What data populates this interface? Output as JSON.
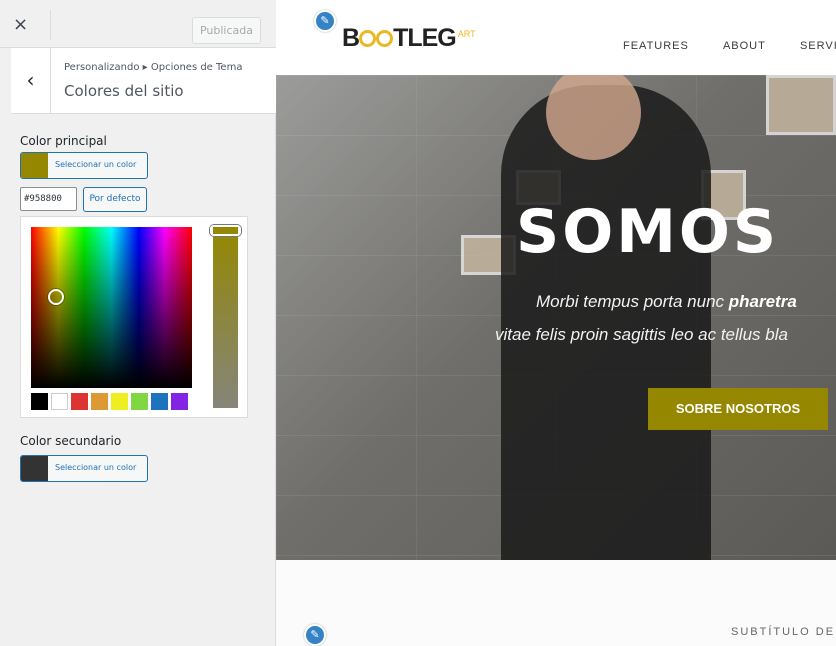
{
  "customizer": {
    "close_icon": "×",
    "publish_label": "Publicada",
    "back_icon": "‹",
    "breadcrumb": "Personalizando ▸ Opciones de Tema",
    "section_title": "Colores del sitio",
    "primary": {
      "label": "Color principal",
      "button_label": "Seleccionar un color",
      "color": "#958800",
      "hex_value": "#958800",
      "default_label": "Por defecto"
    },
    "palette": [
      "#000000",
      "#ffffff",
      "#dd3333",
      "#dd9933",
      "#eeee22",
      "#81d742",
      "#1e73be",
      "#8224e3"
    ],
    "secondary": {
      "label": "Color secundario",
      "button_label": "Seleccionar un color",
      "color": "#333333"
    }
  },
  "preview": {
    "edit_icon": "✎",
    "logo": {
      "pre": "B",
      "post": "TLEG",
      "sup": "ART"
    },
    "nav": [
      "FEATURES",
      "ABOUT",
      "SERVICE"
    ],
    "hero": {
      "title": "SOMOS",
      "line1_regular": "Morbi tempus porta nunc ",
      "line1_bold": "pharetra",
      "line2": "vitae felis proin sagittis leo ac tellus bla",
      "button_label": "SOBRE NOSOTROS"
    },
    "subtitle": "SUBTÍTULO DE"
  }
}
